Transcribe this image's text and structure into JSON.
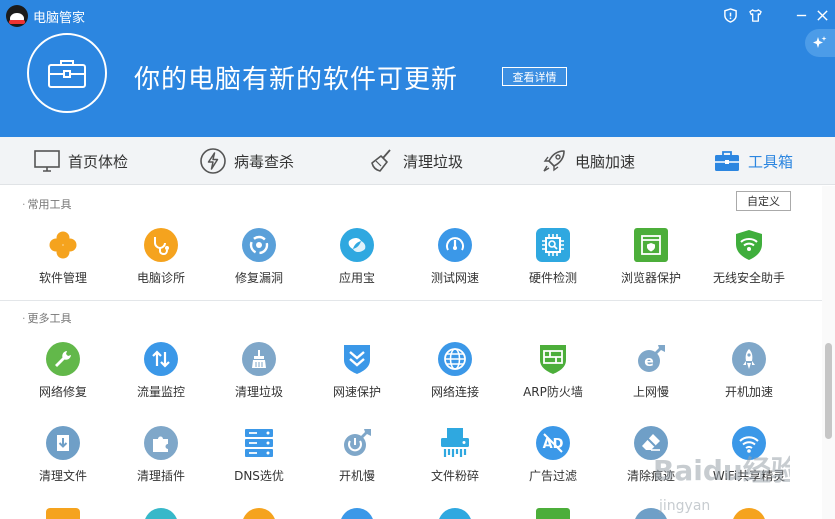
{
  "window": {
    "title": "电脑管家",
    "controls": [
      "shield-icon",
      "shirt-icon",
      "minimize-icon",
      "close-icon"
    ]
  },
  "hero": {
    "message": "你的电脑有新的软件可更新",
    "detail_button": "查看详情",
    "icon": "toolbox-icon"
  },
  "nav": {
    "items": [
      {
        "label": "首页体检",
        "icon": "monitor-icon",
        "active": false
      },
      {
        "label": "病毒查杀",
        "icon": "bolt-icon",
        "active": false
      },
      {
        "label": "清理垃圾",
        "icon": "broom-icon",
        "active": false
      },
      {
        "label": "电脑加速",
        "icon": "rocket-icon",
        "active": false
      },
      {
        "label": "工具箱",
        "icon": "toolbox-icon",
        "active": true
      }
    ]
  },
  "common": {
    "title": "常用工具",
    "custom_button": "自定义",
    "tools": [
      {
        "label": "软件管理",
        "icon": "clover-icon",
        "color": "#f5a31e"
      },
      {
        "label": "电脑诊所",
        "icon": "stethoscope-icon",
        "color": "#f5a31e"
      },
      {
        "label": "修复漏洞",
        "icon": "patch-icon",
        "color": "#5aa0d9"
      },
      {
        "label": "应用宝",
        "icon": "app-store-icon",
        "color": "#2fa8e0"
      },
      {
        "label": "测试网速",
        "icon": "speed-test-icon",
        "color": "#3b98e8"
      },
      {
        "label": "硬件检测",
        "icon": "chip-icon",
        "color": "#2fa8e0"
      },
      {
        "label": "浏览器保护",
        "icon": "browser-shield-icon",
        "color": "#4cae3a"
      },
      {
        "label": "无线安全助手",
        "icon": "wifi-shield-icon",
        "color": "#3fae3c"
      }
    ]
  },
  "more": {
    "title": "更多工具",
    "row1": [
      {
        "label": "网络修复",
        "icon": "wrench-icon",
        "color": "#62b84a"
      },
      {
        "label": "流量监控",
        "icon": "updown-arrows-icon",
        "color": "#3b98e8"
      },
      {
        "label": "清理垃圾",
        "icon": "broom-icon",
        "color": "#7fa7c9"
      },
      {
        "label": "网速保护",
        "icon": "shield-chevron-icon",
        "color": "#3b98e8"
      },
      {
        "label": "网络连接",
        "icon": "globe-icon",
        "color": "#3b98e8"
      },
      {
        "label": "ARP防火墙",
        "icon": "firewall-icon",
        "color": "#4cae3a"
      },
      {
        "label": "上网慢",
        "icon": "ie-rocket-icon",
        "color": "#7fa7c9"
      },
      {
        "label": "开机加速",
        "icon": "power-rocket-icon",
        "color": "#7fa7c9"
      }
    ],
    "row2": [
      {
        "label": "清理文件",
        "icon": "file-clean-icon",
        "color": "#6f9fc7"
      },
      {
        "label": "清理插件",
        "icon": "puzzle-icon",
        "color": "#7fa7c9"
      },
      {
        "label": "DNS选优",
        "icon": "server-icon",
        "color": "#3b98e8"
      },
      {
        "label": "开机慢",
        "icon": "slow-boot-icon",
        "color": "#7fa7c9"
      },
      {
        "label": "文件粉碎",
        "icon": "shredder-icon",
        "color": "#2fa8e0"
      },
      {
        "label": "广告过滤",
        "icon": "ad-block-icon",
        "color": "#3b98e8"
      },
      {
        "label": "清除痕迹",
        "icon": "eraser-icon",
        "color": "#6f9fc7"
      },
      {
        "label": "WiFi共享精灵",
        "icon": "wifi-share-icon",
        "color": "#3b98e8"
      }
    ],
    "row3_colors": [
      "#f5a31e",
      "#37b8c9",
      "#f5a31e",
      "#3b98e8",
      "#2fa8e0",
      "#4cae3a",
      "#6f9fc7",
      "#f5a31e"
    ]
  },
  "watermark": {
    "text": "Baidu经验",
    "sub": "jingyan"
  }
}
